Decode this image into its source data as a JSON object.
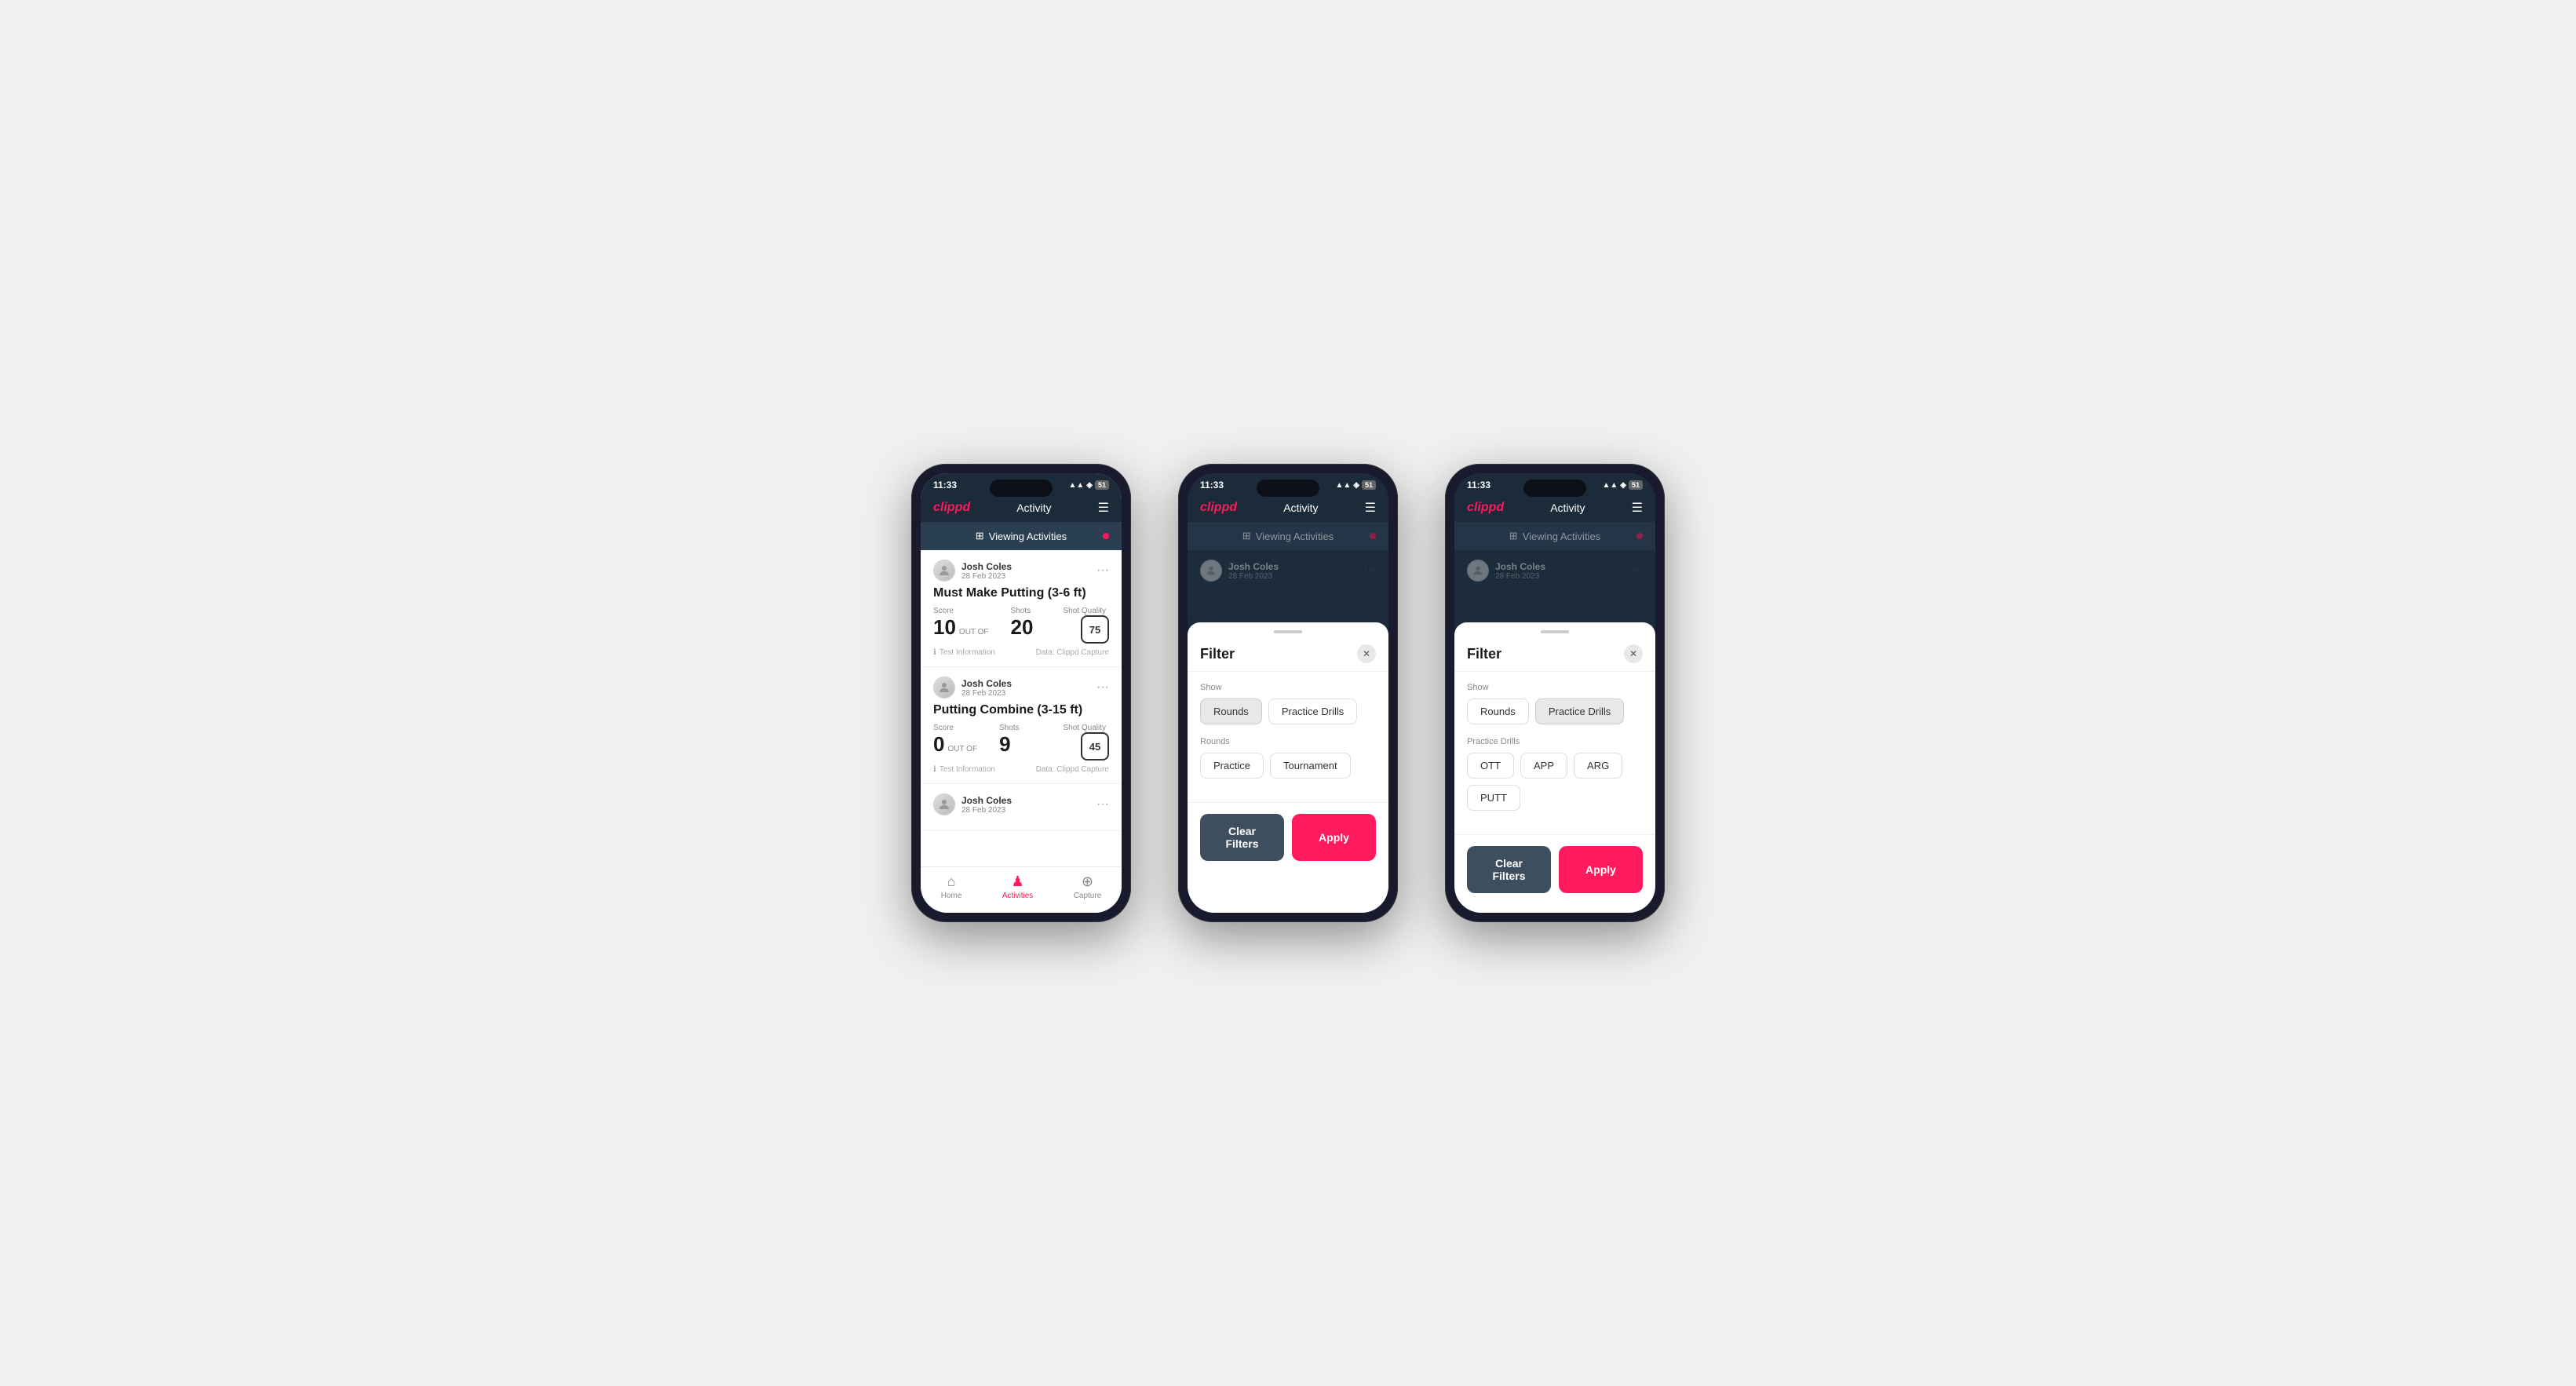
{
  "phones": [
    {
      "id": "phone1",
      "status": {
        "time": "11:33",
        "icons": "▲ ◈ 📶"
      },
      "nav": {
        "logo": "clippd",
        "title": "Activity",
        "menu_icon": "☰"
      },
      "banner": {
        "text": "Viewing Activities",
        "icon": "⊞"
      },
      "activities": [
        {
          "user_name": "Josh Coles",
          "user_date": "28 Feb 2023",
          "title": "Must Make Putting (3-6 ft)",
          "score_label": "Score",
          "score_value": "10",
          "out_of_label": "OUT OF",
          "shots_label": "Shots",
          "shots_value": "20",
          "shot_quality_label": "Shot Quality",
          "shot_quality_value": "75",
          "info_label": "Test Information",
          "data_label": "Data: Clippd Capture"
        },
        {
          "user_name": "Josh Coles",
          "user_date": "28 Feb 2023",
          "title": "Putting Combine (3-15 ft)",
          "score_label": "Score",
          "score_value": "0",
          "out_of_label": "OUT OF",
          "shots_label": "Shots",
          "shots_value": "9",
          "shot_quality_label": "Shot Quality",
          "shot_quality_value": "45",
          "info_label": "Test Information",
          "data_label": "Data: Clippd Capture"
        },
        {
          "user_name": "Josh Coles",
          "user_date": "28 Feb 2023",
          "title": "",
          "score_label": "",
          "score_value": "",
          "out_of_label": "",
          "shots_label": "",
          "shots_value": "",
          "shot_quality_label": "",
          "shot_quality_value": "",
          "info_label": "",
          "data_label": ""
        }
      ],
      "tabs": [
        {
          "label": "Home",
          "icon": "⌂",
          "active": false
        },
        {
          "label": "Activities",
          "icon": "♟",
          "active": true
        },
        {
          "label": "Capture",
          "icon": "⊕",
          "active": false
        }
      ]
    },
    {
      "id": "phone2",
      "filter": {
        "title": "Filter",
        "show_label": "Show",
        "show_buttons": [
          {
            "label": "Rounds",
            "active": true
          },
          {
            "label": "Practice Drills",
            "active": false
          }
        ],
        "rounds_label": "Rounds",
        "rounds_buttons": [
          {
            "label": "Practice",
            "active": false
          },
          {
            "label": "Tournament",
            "active": false
          }
        ],
        "clear_label": "Clear Filters",
        "apply_label": "Apply"
      }
    },
    {
      "id": "phone3",
      "filter": {
        "title": "Filter",
        "show_label": "Show",
        "show_buttons": [
          {
            "label": "Rounds",
            "active": false
          },
          {
            "label": "Practice Drills",
            "active": true
          }
        ],
        "practice_drills_label": "Practice Drills",
        "practice_drills_buttons": [
          {
            "label": "OTT",
            "active": false
          },
          {
            "label": "APP",
            "active": false
          },
          {
            "label": "ARG",
            "active": false
          },
          {
            "label": "PUTT",
            "active": false
          }
        ],
        "clear_label": "Clear Filters",
        "apply_label": "Apply"
      }
    }
  ],
  "colors": {
    "brand": "#ff1a5e",
    "nav_bg": "#1c2b3a",
    "banner_bg": "#2a3f52",
    "clear_btn": "#3d4f5f"
  }
}
